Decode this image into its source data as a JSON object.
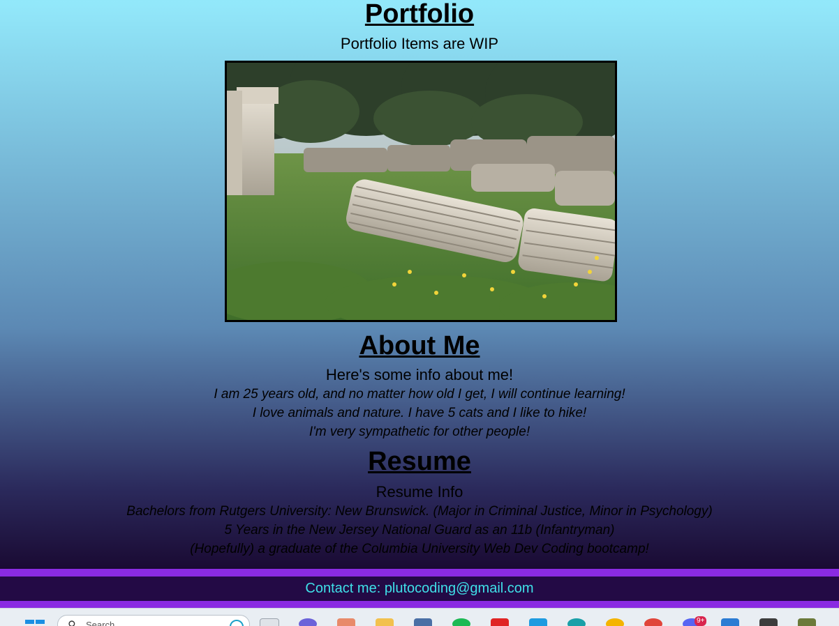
{
  "portfolio": {
    "title": "Portfolio",
    "subtitle": "Portfolio Items are WIP"
  },
  "about": {
    "title": "About Me",
    "subtitle": "Here's some info about me!",
    "lines": [
      "I am 25 years old, and no matter how old I get, I will continue learning!",
      "I love animals and nature. I have 5 cats and I like to hike!",
      "I'm very sympathetic for other people!"
    ]
  },
  "resume": {
    "title": "Resume",
    "subtitle": "Resume Info",
    "lines": [
      "Bachelors from Rutgers University: New Brunswick. (Major in Criminal Justice, Minor in Psychology)",
      "5 Years in the New Jersey National Guard as an 11b (Infantryman)",
      "(Hopefully) a graduate of the Columbia University Web Dev Coding bootcamp!"
    ]
  },
  "footer": {
    "contact_label": "Contact me: ",
    "contact_email": "plutocoding@gmail.com"
  },
  "taskbar": {
    "search_placeholder": "Search",
    "notification_badge": "9+"
  },
  "colors": {
    "accent_bar": "#8a2be2",
    "footer_bg": "#230a45",
    "contact_text": "#3fe0e8"
  }
}
